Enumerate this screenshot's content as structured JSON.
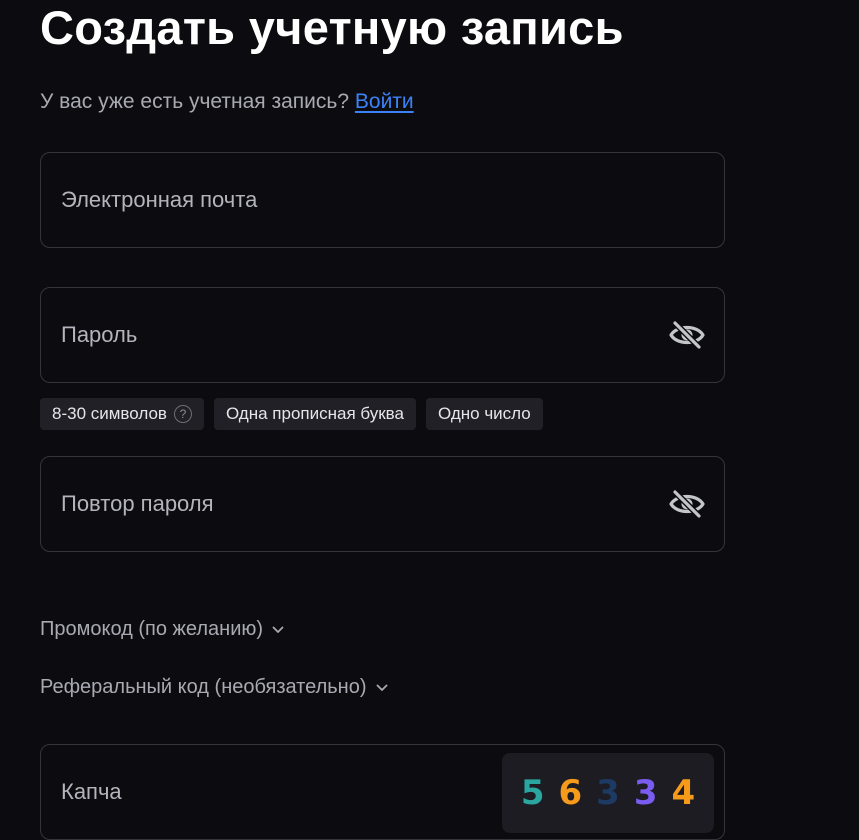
{
  "title": "Создать учетную запись",
  "subtitle": {
    "text": "У вас уже есть учетная запись?",
    "login_link": "Войти"
  },
  "email": {
    "placeholder": "Электронная почта",
    "value": ""
  },
  "password": {
    "placeholder": "Пароль",
    "value": "",
    "toggle_icon": "eye-off-icon"
  },
  "password_rules": [
    {
      "label": "8-30 символов",
      "help_icon": "?"
    },
    {
      "label": "Одна прописная буква"
    },
    {
      "label": "Одно число"
    }
  ],
  "repeat_password": {
    "placeholder": "Повтор пароля",
    "value": "",
    "toggle_icon": "eye-off-icon"
  },
  "promo_toggle": "Промокод (по желанию)",
  "referral_toggle": "Реферальный код (необязательно)",
  "captcha": {
    "placeholder": "Капча",
    "value": "",
    "digits": [
      {
        "char": "5",
        "color": "#2aa5a0"
      },
      {
        "char": "6",
        "color": "#f59a1b"
      },
      {
        "char": "3",
        "color": "#1d3a63"
      },
      {
        "char": "3",
        "color": "#7b5cf0"
      },
      {
        "char": "4",
        "color": "#f59a1b"
      }
    ]
  },
  "colors": {
    "background": "#0c0c10",
    "link": "#3b82f6",
    "field_border": "#34343c",
    "chip_bg": "#202026"
  }
}
